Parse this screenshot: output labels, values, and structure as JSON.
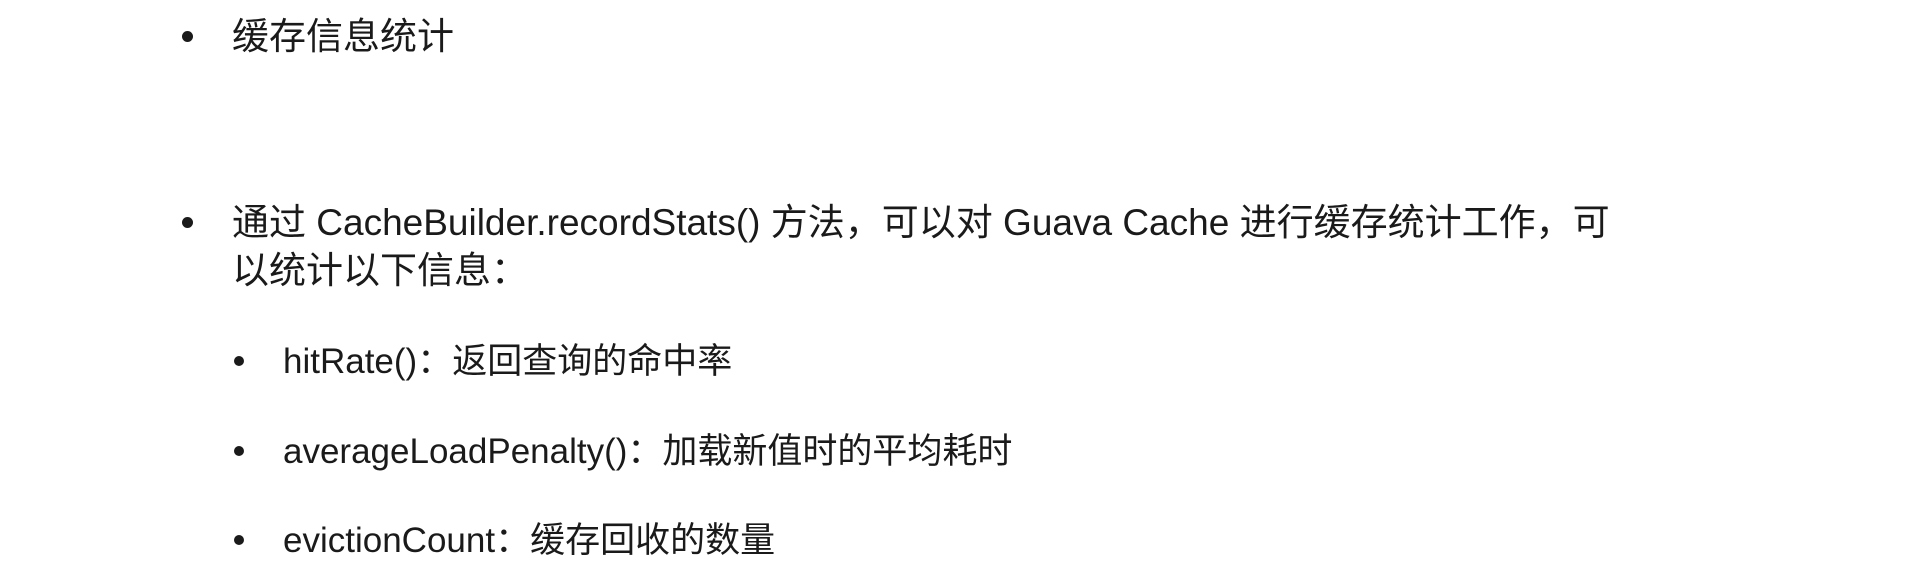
{
  "bullets": [
    {
      "text": "缓存信息统计"
    },
    {
      "line1": "通过 CacheBuilder.recordStats() 方法，可以对 Guava Cache 进行缓存统计工作，可",
      "line2": "以统计以下信息："
    }
  ],
  "sub_bullets": [
    {
      "text": "hitRate()：返回查询的命中率"
    },
    {
      "text": "averageLoadPenalty()：加载新值时的平均耗时"
    },
    {
      "text": "evictionCount：缓存回收的数量"
    }
  ]
}
